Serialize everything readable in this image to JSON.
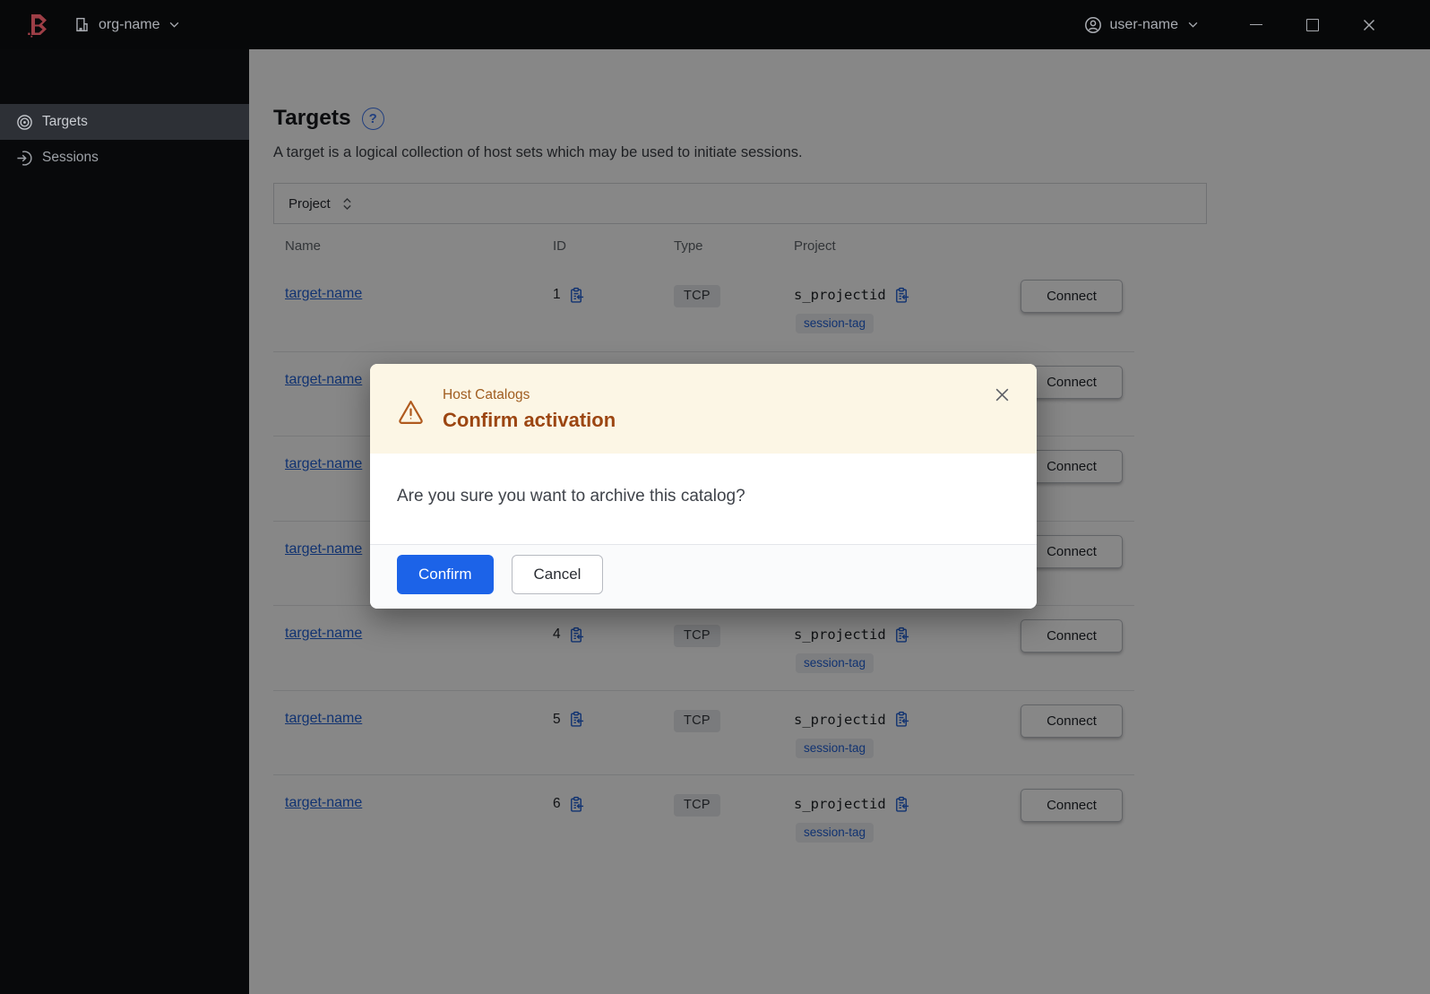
{
  "titlebar": {
    "org_label": "org-name",
    "user_label": "user-name"
  },
  "sidebar": {
    "items": [
      {
        "label": "Targets",
        "icon": "target-icon",
        "active": true
      },
      {
        "label": "Sessions",
        "icon": "session-icon",
        "active": false
      }
    ]
  },
  "page": {
    "title": "Targets",
    "help_icon": "?",
    "description": "A target is a logical collection of host sets which may be used to initiate sessions.",
    "filter": {
      "label": "Project"
    },
    "table": {
      "headers": [
        "Name",
        "ID",
        "Type",
        "Project"
      ],
      "connect_label": "Connect",
      "rows": [
        {
          "name": "target-name",
          "id": "1",
          "type": "TCP",
          "project": "s_projectid",
          "session_tag": "session-tag"
        },
        {
          "name": "target-name",
          "id": "",
          "type": "",
          "project": "",
          "session_tag": ""
        },
        {
          "name": "target-name",
          "id": "",
          "type": "",
          "project": "",
          "session_tag": ""
        },
        {
          "name": "target-name",
          "id": "",
          "type": "",
          "project": "",
          "session_tag": ""
        },
        {
          "name": "target-name",
          "id": "4",
          "type": "TCP",
          "project": "s_projectid",
          "session_tag": "session-tag"
        },
        {
          "name": "target-name",
          "id": "5",
          "type": "TCP",
          "project": "s_projectid",
          "session_tag": "session-tag"
        },
        {
          "name": "target-name",
          "id": "6",
          "type": "TCP",
          "project": "s_projectid",
          "session_tag": "session-tag"
        }
      ]
    }
  },
  "modal": {
    "context": "Host Catalogs",
    "title": "Confirm activation",
    "body": "Are you sure you want to archive this catalog?",
    "confirm_label": "Confirm",
    "cancel_label": "Cancel"
  },
  "colors": {
    "accent_blue": "#1c63e8",
    "link_blue": "#2160d6",
    "brand_red": "#9d3e46",
    "warning_bg": "#fcf6e5",
    "warning_text": "#9c4612",
    "titlebar_bg": "#070809",
    "overlay": "rgba(0,0,0,0.47)"
  }
}
